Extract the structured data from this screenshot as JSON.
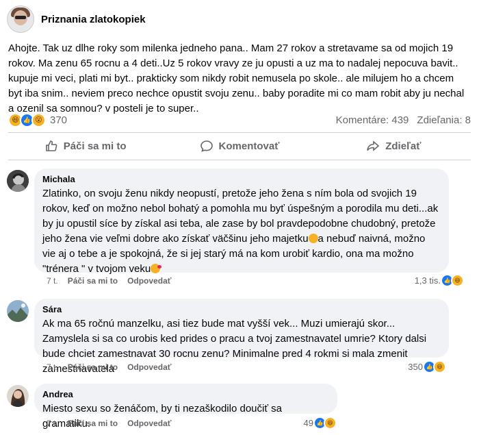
{
  "post": {
    "page_name": "Priznania zlatokopiek",
    "text": "Ahojte. Tak uz dlhe roky som milenka jedneho pana.. Mam 27 rokov a stretavame sa od mojich 19 rokov. Ma zenu 65 rocnu a 4 deti..Uz 5 rokov vravy ze ju opusti a uz ma to nadalej nepocuva bavit.. kupuje mi veci, plati mi byt.. prakticky som nikdy robit nemusela po skole.. ale milujem ho a chcem byt iba snim.. neviem preco nechce opustit svoju zenu.. baby poradite mi co mam robit aby ju nechal a ozenil sa somnou? v posteli je to super..",
    "reaction_count": "370",
    "comments_label": "Komentáre: 439",
    "shares_label": "Zdieľania: 8",
    "reaction_icons": [
      "haha-icon",
      "like-icon",
      "wow-icon"
    ]
  },
  "actions": {
    "like": "Páči sa mi to",
    "comment": "Komentovať",
    "share": "Zdieľať"
  },
  "comments": [
    {
      "author": "Michala",
      "text_part1": "Zlatinko, on svoju ženu nikdy neopustí, pretože jeho žena s ním bola od svojich 19 rokov, keď on možno nebol bohatý a pomohla mu byť úspešným a porodila mu deti...ak by ju opustil síce by získal asi teba, ale zase by bol pravdepodobne chudobný, pretože jeho žena vie veľmi dobre ako získať väčšinu jeho majetku",
      "text_part2": "a nebuď naivná, možno vie aj o tebe a je spokojná, že si jej starý má na kom urobiť kardio, ona ma možno \"trénera \" v tvojom veku",
      "time": "7 t.",
      "like_label": "Páči sa mi to",
      "reply_label": "Odpovedať",
      "reaction_count": "1,3 tis."
    },
    {
      "author": "Sára",
      "text": "Ak ma 65 ročnú manzelku, asi tiez bude mat vyšší vek... Muzi umierajú skor... Zamyslela si sa co urobis ked prides o pracu a tvoj zamestnavatel umrie? Ktory dalsi bude chciet zamestnavat 30 rocnu zenu? Minimalne pred 4 rokmi si mala zmenit zamestnavatela",
      "time": "7 t.",
      "like_label": "Páči sa mi to",
      "reply_label": "Odpovedať",
      "reaction_count": "350"
    },
    {
      "author": "Andrea",
      "text": "Miesto sexu so ženáčom, by ti nezaškodilo doučiť sa gramatiku.",
      "time": "7 t.",
      "like_label": "Páči sa mi to",
      "reply_label": "Odpovedať",
      "reaction_count": "49"
    }
  ],
  "colors": {
    "like_blue": "#1877f2",
    "bubble_bg": "#f0f2f5",
    "muted_text": "#65676b"
  }
}
